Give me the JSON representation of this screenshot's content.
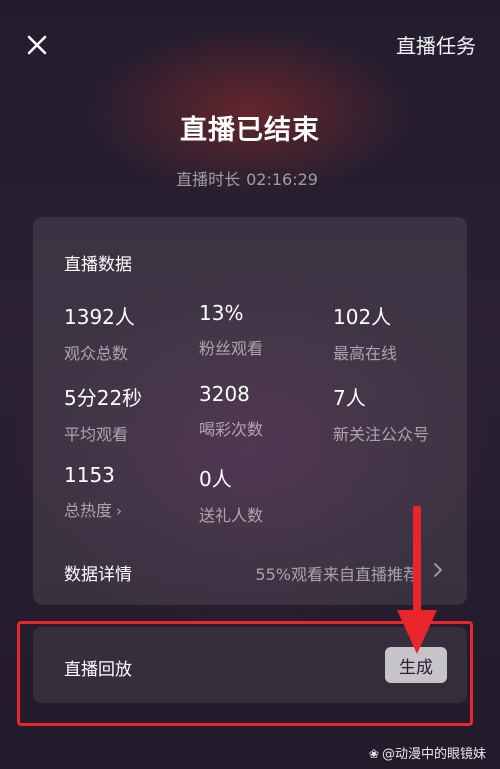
{
  "header": {
    "task_link": "直播任务"
  },
  "summary": {
    "title": "直播已结束",
    "duration_label": "直播时长",
    "duration_value": "02:16:29"
  },
  "stats": {
    "title": "直播数据",
    "items": [
      {
        "value": "1392人",
        "label": "观众总数"
      },
      {
        "value": "13%",
        "label": "粉丝观看"
      },
      {
        "value": "102人",
        "label": "最高在线"
      },
      {
        "value": "5分22秒",
        "label": "平均观看"
      },
      {
        "value": "3208",
        "label": "喝彩次数"
      },
      {
        "value": "7人",
        "label": "新关注公众号"
      },
      {
        "value": "1153",
        "label": "总热度"
      },
      {
        "value": "0人",
        "label": "送礼人数"
      }
    ]
  },
  "details": {
    "label": "数据详情",
    "value": "55%观看来自直播推荐"
  },
  "replay": {
    "label": "直播回放",
    "button": "生成"
  },
  "watermark": {
    "text": "@动漫中的眼镜妹"
  },
  "colors": {
    "annotation_red": "#e8262c",
    "button_bg": "#c9c5cc"
  }
}
